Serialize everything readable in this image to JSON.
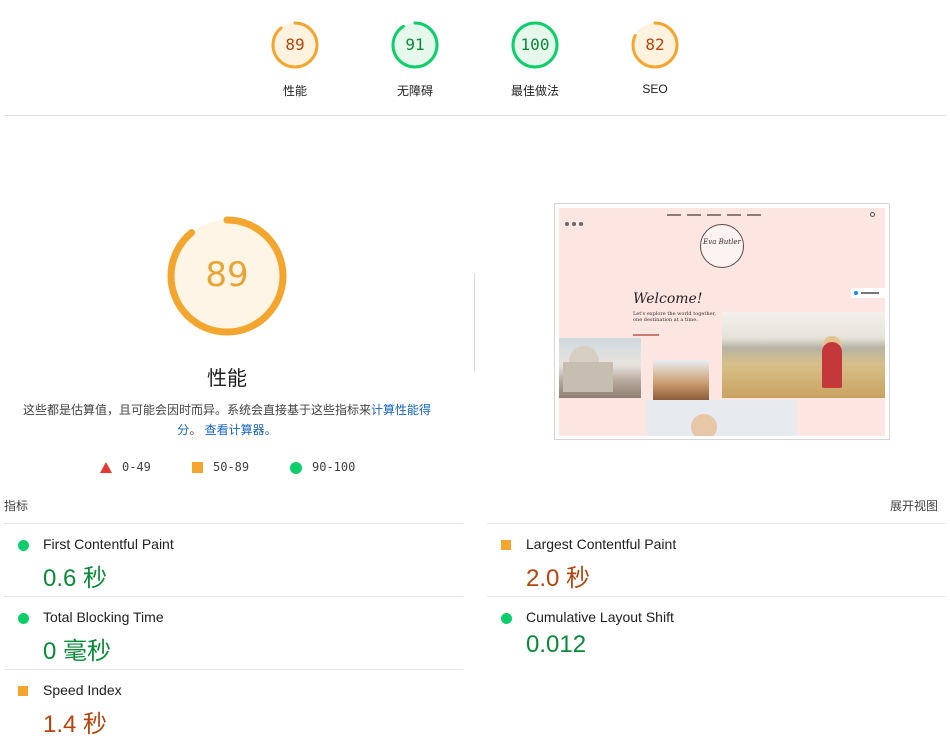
{
  "colors": {
    "good": "#0cce6b",
    "good_text": "#0a8a3a",
    "average": "#f4a52e",
    "average_text": "#b5450b",
    "fail": "#e53935",
    "link": "#1565c0"
  },
  "summary": [
    {
      "score": "89",
      "label": "性能",
      "status": "average"
    },
    {
      "score": "91",
      "label": "无障碍",
      "status": "good"
    },
    {
      "score": "100",
      "label": "最佳做法",
      "status": "good"
    },
    {
      "score": "82",
      "label": "SEO",
      "status": "average"
    }
  ],
  "performance": {
    "score": "89",
    "title": "性能",
    "description_text": "这些都是估算值，且可能会因时而异。系统会直接基于这些指标来",
    "calc_link": "计算性能得分",
    "separator": "。",
    "view_calc_link": "查看计算器。"
  },
  "legend": [
    {
      "range": "0-49",
      "shape": "triangle-icon"
    },
    {
      "range": "50-89",
      "shape": "square-icon"
    },
    {
      "range": "90-100",
      "shape": "circle-icon"
    }
  ],
  "screenshot": {
    "welcome": "Welcome!",
    "subtitle": "Let's explore the world together, one destination at a time.",
    "logo_text": "Eva Butler"
  },
  "metrics": {
    "label": "指标",
    "expand_label": "展开视图",
    "items": [
      {
        "name": "First Contentful Paint",
        "value": "0.6 秒",
        "status": "good"
      },
      {
        "name": "Largest Contentful Paint",
        "value": "2.0 秒",
        "status": "average"
      },
      {
        "name": "Total Blocking Time",
        "value": "0 毫秒",
        "status": "good"
      },
      {
        "name": "Cumulative Layout Shift",
        "value": "0.012",
        "status": "good"
      },
      {
        "name": "Speed Index",
        "value": "1.4 秒",
        "status": "average"
      }
    ]
  }
}
